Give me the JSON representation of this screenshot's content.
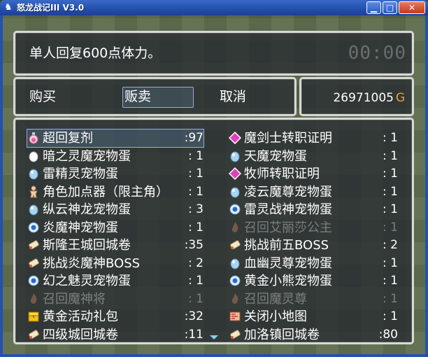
{
  "window": {
    "title": "怒龙战记III V3.0",
    "minimize": "▁",
    "maximize": "□",
    "close": "✕"
  },
  "help": {
    "text": "单人回复600点体力。",
    "clock": "00:00"
  },
  "commands": [
    "购买",
    "贩卖",
    "取消"
  ],
  "gold": {
    "amount": "26971005",
    "unit": "G"
  },
  "items": [
    {
      "name": "超回复剂",
      "count": ":97",
      "icon": "potion-icon",
      "selected": true
    },
    {
      "name": "魔剑士转职证明",
      "count": ":  1",
      "icon": "diamond-icon"
    },
    {
      "name": "暗之灵魔宠物蛋",
      "count": ":  1",
      "icon": "egg-white-icon"
    },
    {
      "name": "天魔宠物蛋",
      "count": ":  1",
      "icon": "egg-blue-icon"
    },
    {
      "name": "雷精灵宠物蛋",
      "count": ":  1",
      "icon": "egg-blue-icon"
    },
    {
      "name": "牧师转职证明",
      "count": ":  1",
      "icon": "diamond-icon"
    },
    {
      "name": "角色加点器（限主角）",
      "count": ":  1",
      "icon": "figure-icon"
    },
    {
      "name": "凌云魔尊宠物蛋",
      "count": ":  1",
      "icon": "egg-blue-icon"
    },
    {
      "name": "纵云神龙宠物蛋",
      "count": ":  3",
      "icon": "egg-blue-icon"
    },
    {
      "name": "雷灵战神宠物蛋",
      "count": ":  1",
      "icon": "orb-icon"
    },
    {
      "name": "炎魔神宠物蛋",
      "count": ":  1",
      "icon": "orb-icon"
    },
    {
      "name": "召回艾丽莎公主",
      "count": ":  1",
      "icon": "flame-icon",
      "disabled": true
    },
    {
      "name": "斯隆王城回城卷",
      "count": ":35",
      "icon": "scroll-icon"
    },
    {
      "name": "挑战前五BOSS",
      "count": ":  2",
      "icon": "scroll-icon"
    },
    {
      "name": "挑战炎魔神BOSS",
      "count": ":  2",
      "icon": "scroll-icon"
    },
    {
      "name": "血幽灵尊宠物蛋",
      "count": ":  1",
      "icon": "egg-blue-icon"
    },
    {
      "name": "幻之魅灵宠物蛋",
      "count": ":  1",
      "icon": "orb-icon"
    },
    {
      "name": "黄金小熊宠物蛋",
      "count": ":  1",
      "icon": "orb-icon"
    },
    {
      "name": "召回魔神将",
      "count": ":  1",
      "icon": "flame-icon",
      "disabled": true
    },
    {
      "name": "召回魔灵尊",
      "count": ":  1",
      "icon": "flame-icon",
      "disabled": true
    },
    {
      "name": "黄金活动礼包",
      "count": ":32",
      "icon": "chest-icon"
    },
    {
      "name": "关闭小地图",
      "count": ":  1",
      "icon": "map-icon"
    },
    {
      "name": "四级城回城卷",
      "count": ":11",
      "icon": "scroll-icon"
    },
    {
      "name": "加洛镇回城卷",
      "count": ":80",
      "icon": "scroll-icon"
    }
  ],
  "colors": {
    "window_border": "#d8d8d8",
    "gold_unit": "#e8a040",
    "cursor": "#99aadd"
  }
}
